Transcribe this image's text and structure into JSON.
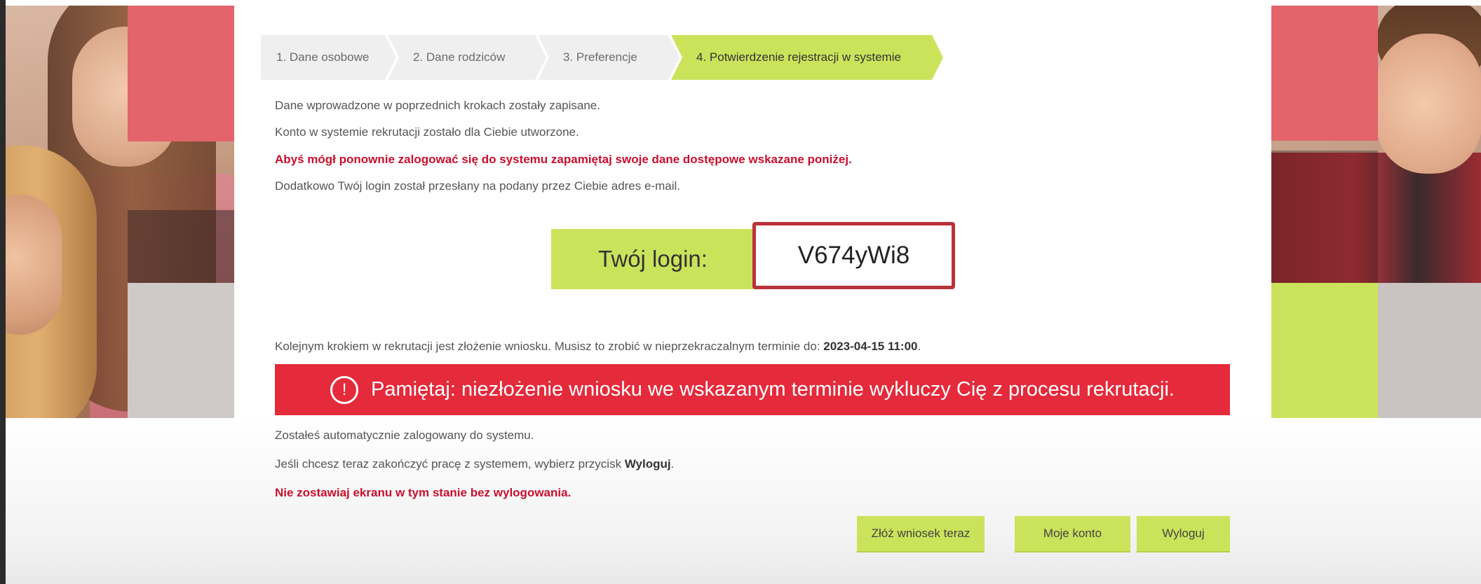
{
  "steps": [
    {
      "label": "1. Dane osobowe"
    },
    {
      "label": "2. Dane rodziców"
    },
    {
      "label": "3. Preferencje"
    },
    {
      "label": "4. Potwierdzenie rejestracji w systemie"
    }
  ],
  "intro": {
    "line1": "Dane wprowadzone w poprzednich krokach zostały zapisane.",
    "line2": "Konto w systemie rekrutacji zostało dla Ciebie utworzone.",
    "line3_warning": "Abyś mógł ponownie zalogować się do systemu zapamiętaj swoje dane dostępowe wskazane poniżej.",
    "line4": "Dodatkowo Twój login został przesłany na podany przez Ciebie adres e-mail."
  },
  "login": {
    "label": "Twój login:",
    "value": "V674yWi8"
  },
  "deadline": {
    "text": "Kolejnym krokiem w rekrutacji jest złożenie wniosku. Musisz to zrobić w nieprzekraczalnym terminie do: ",
    "date": "2023-04-15 11:00",
    "suffix": "."
  },
  "alert": {
    "icon_glyph": "!",
    "icon": "exclamation-circle-icon",
    "text": "Pamiętaj: niezłożenie wniosku we wskazanym terminie wykluczy Cię z procesu rekrutacji."
  },
  "after": {
    "line1": "Zostałeś automatycznie zalogowany do systemu.",
    "line2_prefix": "Jeśli chcesz teraz zakończyć pracę z systemem, wybierz przycisk ",
    "line2_bold": "Wyloguj",
    "line2_suffix": ".",
    "line3_warning": "Nie zostawiaj ekranu w tym stanie bez wylogowania."
  },
  "buttons": {
    "apply": "Złóż wniosek teraz",
    "account": "Moje konto",
    "logout": "Wyloguj"
  },
  "colors": {
    "accent_green": "#cbe35b",
    "alert_red": "#e42a3b",
    "warning_text": "#c8102e",
    "login_border": "#b9333b"
  }
}
